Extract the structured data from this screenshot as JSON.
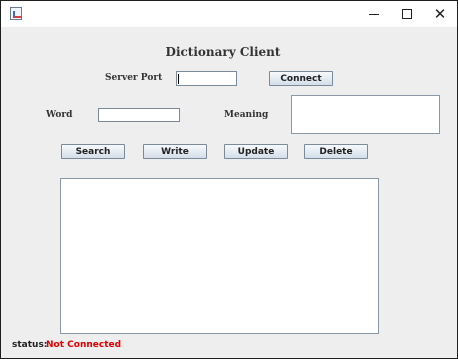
{
  "window": {
    "minimize_symbol": "",
    "maximize_symbol": "",
    "close_symbol": "✕"
  },
  "app": {
    "title": "Dictionary Client"
  },
  "connection": {
    "server_port_label": "Server Port",
    "server_port_value": "",
    "connect_label": "Connect"
  },
  "entry": {
    "word_label": "Word",
    "word_value": "",
    "meaning_label": "Meaning",
    "meaning_value": ""
  },
  "actions": {
    "search_label": "Search",
    "write_label": "Write",
    "update_label": "Update",
    "delete_label": "Delete"
  },
  "output": {
    "text": ""
  },
  "status": {
    "label": "status:",
    "value": "Not Connected",
    "value_color": "#e00000"
  }
}
